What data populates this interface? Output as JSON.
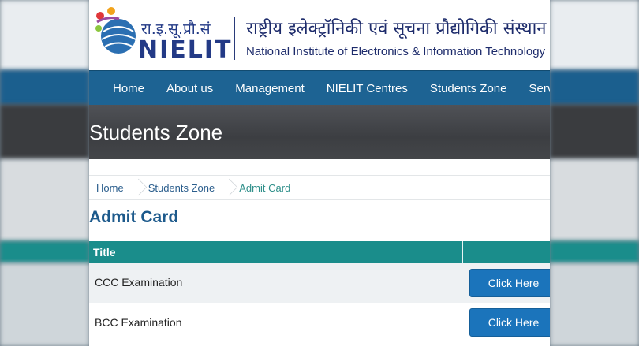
{
  "header": {
    "logo_hindi": "रा.इ.सू.प्रौ.सं",
    "logo_word": "NIELIT",
    "title_hindi": "राष्ट्रीय इलेक्ट्रॉनिकी एवं सूचना प्रौद्योगिकी संस्थान",
    "title_en": "National Institute of Electronics & Information Technology"
  },
  "nav": {
    "items": [
      {
        "label": "Home"
      },
      {
        "label": "About us"
      },
      {
        "label": "Management"
      },
      {
        "label": "NIELIT Centres"
      },
      {
        "label": "Students Zone"
      },
      {
        "label": "Servic"
      }
    ]
  },
  "hero": {
    "title": "Students Zone"
  },
  "breadcrumb": {
    "items": [
      {
        "label": "Home"
      },
      {
        "label": "Students Zone"
      },
      {
        "label": "Admit Card"
      }
    ]
  },
  "page": {
    "heading": "Admit Card"
  },
  "table": {
    "header_title": "Title",
    "rows": [
      {
        "label": "CCC Examination",
        "button": "Click Here"
      },
      {
        "label": "BCC Examination",
        "button": "Click Here"
      }
    ]
  },
  "colors": {
    "nav_bg": "#1d6393",
    "table_header": "#1a8d8b",
    "button": "#1b74bb",
    "heading": "#1d5a8c"
  }
}
